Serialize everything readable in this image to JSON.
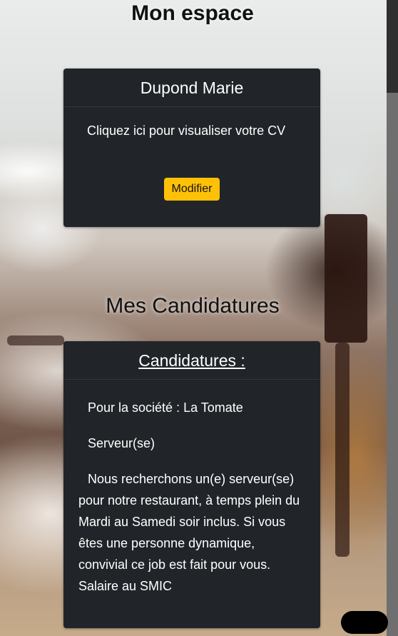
{
  "header": {
    "title": "Mon espace"
  },
  "profile_card": {
    "name": "Dupond Marie",
    "cv_link": "Cliquez ici pour visualiser votre CV",
    "edit_button": "Modifier"
  },
  "applications_section": {
    "title": "Mes Candidatures"
  },
  "applications_card": {
    "header": "Candidatures :",
    "company": "Pour la société : La Tomate",
    "position": "Serveur(se)",
    "description": "Nous recherchons un(e) serveur(se) pour notre restaurant, à temps plein du Mardi au Samedi soir inclus. Si vous êtes une personne dynamique, convivial ce job est fait pour vous. Salaire au SMIC"
  },
  "colors": {
    "card_bg": "#212529",
    "button_bg": "#ffc107"
  }
}
